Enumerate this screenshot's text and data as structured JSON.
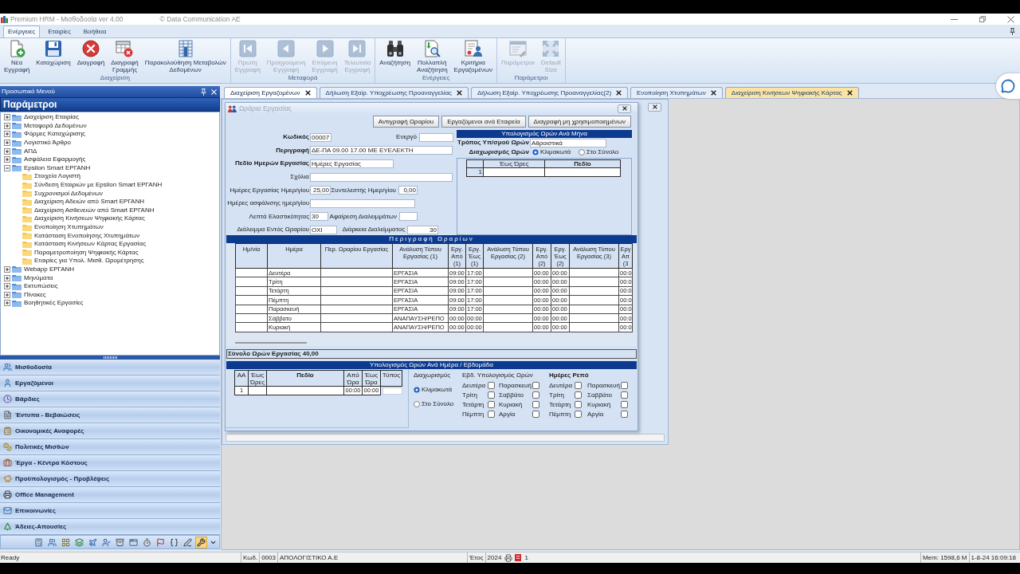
{
  "window": {
    "title": "Premium HRM - Μισθοδοσία ver 4.00",
    "copyright": "© Data Communication AE"
  },
  "ribbon": {
    "tabs": [
      {
        "label": "Ενέργειες",
        "selected": true
      },
      {
        "label": "Εταιρίες",
        "selected": false
      },
      {
        "label": "Βοήθεια",
        "selected": false
      }
    ],
    "groups": [
      {
        "label": "Διαχείριση",
        "buttons": [
          {
            "kind": "new",
            "lines": [
              "Νέα",
              "Εγγραφή"
            ],
            "disabled": false
          },
          {
            "kind": "save",
            "lines": [
              "Καταχώριση"
            ],
            "disabled": false
          },
          {
            "kind": "delete",
            "lines": [
              "Διαγραφή"
            ],
            "disabled": false
          },
          {
            "kind": "delete_row",
            "lines": [
              "Διαγραφή",
              "Γραμμής"
            ],
            "disabled": false
          },
          {
            "kind": "track",
            "lines": [
              "Παρακολούθηση Μεταβολών",
              "Δεδομένων"
            ],
            "disabled": false
          }
        ]
      },
      {
        "label": "Μεταφορά",
        "buttons": [
          {
            "kind": "first",
            "lines": [
              "Πρώτη",
              "Εγγραφή"
            ],
            "disabled": true
          },
          {
            "kind": "prev",
            "lines": [
              "Προηγούμενη",
              "Εγγραφή"
            ],
            "disabled": true
          },
          {
            "kind": "next",
            "lines": [
              "Επόμενη",
              "Εγγραφή"
            ],
            "disabled": true
          },
          {
            "kind": "last",
            "lines": [
              "Τελευταία",
              "Εγγραφή"
            ],
            "disabled": true
          }
        ]
      },
      {
        "label": "Ενέργειες",
        "buttons": [
          {
            "kind": "search",
            "lines": [
              "Αναζήτηση"
            ],
            "disabled": false
          },
          {
            "kind": "multi_search",
            "lines": [
              "Πολλαπλή",
              "Αναζήτηση"
            ],
            "disabled": false
          },
          {
            "kind": "criteria",
            "lines": [
              "Κριτήρια",
              "Εργαζομένων"
            ],
            "disabled": false
          }
        ]
      },
      {
        "label": "Παράμετροι",
        "buttons": [
          {
            "kind": "params",
            "lines": [
              "Παράμετροι"
            ],
            "disabled": true
          },
          {
            "kind": "default_size",
            "lines": [
              "Default",
              "Size"
            ],
            "disabled": true
          }
        ]
      }
    ]
  },
  "personal_menu": {
    "title": "Προσωπικό Μενού",
    "section": "Παράμετροι",
    "tree": [
      {
        "label": "Διαχείριση Εταιρίας",
        "expanded": false
      },
      {
        "label": "Μεταφορά Δεδομένων",
        "expanded": false
      },
      {
        "label": "Φόρμες Καταχώρισης",
        "expanded": false
      },
      {
        "label": "Λογιστικό Άρθρο",
        "expanded": false
      },
      {
        "label": "ΑΠΔ",
        "expanded": false
      },
      {
        "label": "Ασφάλεια Εφαρμογής",
        "expanded": false
      },
      {
        "label": "Epsilon Smart ΕΡΓΑΝΗ",
        "expanded": true,
        "children": [
          {
            "label": "Στοιχεία Λογιστή"
          },
          {
            "label": "Σύνδεση Εταιριών με Epsilon Smart ΕΡΓΑΝΗ"
          },
          {
            "label": "Συχρονισμοί Δεδομένων"
          },
          {
            "label": "Διαχείριση Αδειών από Smart ΕΡΓΑΝΗ"
          },
          {
            "label": "Διαχείριση Ασθενειών από Smart ΕΡΓΑΝΗ"
          },
          {
            "label": "Διαχείριση Κινήσεων Ψηφιακής Κάρτας"
          },
          {
            "label": "Ενοποίηση Χτυπημάτων"
          },
          {
            "label": "Κατάσταση Ενοποίησης Χτυπημάτων"
          },
          {
            "label": "Κατάσταση Κινήσεων Κάρτας Εργασίας"
          },
          {
            "label": "Παραμετροποίηση Ψηφιακής Κάρτας"
          },
          {
            "label": "Εταιρίες για Υπολ. Μισθ. Ωρομέτρησης"
          }
        ]
      },
      {
        "label": "Webapp ΕΡΓΑΝΗ",
        "expanded": false
      },
      {
        "label": "Μηνύματα",
        "expanded": false
      },
      {
        "label": "Εκτυπώσεις",
        "expanded": false
      },
      {
        "label": "Πίνακες",
        "expanded": false
      },
      {
        "label": "Βοηθητικές Εργασίες",
        "expanded": false
      }
    ],
    "nav_items": [
      {
        "label": "Μισθοδοσία",
        "kind": "payroll"
      },
      {
        "label": "Εργαζόμενοι",
        "kind": "employees"
      },
      {
        "label": "Βάρδιες",
        "kind": "shifts"
      },
      {
        "label": "Έντυπα - Βεβαιώσεις",
        "kind": "forms"
      },
      {
        "label": "Οικονομικές Αναφορές",
        "kind": "reports"
      },
      {
        "label": "Πολιτικές Μισθών",
        "kind": "policies"
      },
      {
        "label": "Έργα - Κέντρα Κόστους",
        "kind": "projects"
      },
      {
        "label": "Προϋπολογισμός - Προβλέψεις",
        "kind": "budget"
      },
      {
        "label": "Office Management",
        "kind": "office"
      },
      {
        "label": "Επικοινωνίες",
        "kind": "communication"
      },
      {
        "label": "Άδειες-Απουσίες",
        "kind": "leave"
      }
    ],
    "shortcuts": [
      {
        "kind": "calculator",
        "selected": false
      },
      {
        "kind": "users",
        "selected": false
      },
      {
        "kind": "grid",
        "selected": false
      },
      {
        "kind": "layers",
        "selected": false
      },
      {
        "kind": "plane",
        "selected": false
      },
      {
        "kind": "user_check",
        "selected": false
      },
      {
        "kind": "archive",
        "selected": false
      },
      {
        "kind": "window",
        "selected": false
      },
      {
        "kind": "timer",
        "selected": false
      },
      {
        "kind": "flag",
        "selected": false
      },
      {
        "kind": "braces",
        "selected": false
      },
      {
        "kind": "pen",
        "selected": false
      },
      {
        "kind": "wrench",
        "selected": true
      }
    ]
  },
  "doc_tabs": [
    {
      "label": "Διαχείριση Εργαζομένων",
      "selected": true,
      "highlighted": false
    },
    {
      "label": "Δήλωση Εξαίρ. Υποχρέωσης Προαναγγελίας",
      "selected": false,
      "highlighted": false
    },
    {
      "label": "Δήλωση Εξαίρ. Υποχρέωσης Προαναγγελίας(2)",
      "selected": false,
      "highlighted": false
    },
    {
      "label": "Ενοποίηση Χτυπημάτων",
      "selected": false,
      "highlighted": false
    },
    {
      "label": "Διαχείριση Κινήσεων Ψηφιακής Κάρτας",
      "selected": false,
      "highlighted": true
    }
  ],
  "dialog": {
    "title": "Ωράρια Εργασίας",
    "buttons": [
      "Αντιγραφή Ωραρίου",
      "Εργαζόμενοι ανά Εταιρεία",
      "Διαγραφή μη χρησιμοποιημένων"
    ],
    "form": [
      [
        {
          "label": "Κωδικός",
          "value": "00007",
          "bold": true
        },
        {
          "label": "Ενεργό",
          "bold": false
        }
      ],
      [
        {
          "label": "Περιγραφή",
          "value": "ΔΕ-ΠΑ 09.00 17.00 ΜΕ ΕΥΕΛΕΚΤΗ",
          "bold": true
        }
      ],
      [
        {
          "label": "Πεδίο Ημερών Εργασίας",
          "value": "Ημέρες Εργασίας",
          "bold": true
        }
      ],
      [
        {
          "label": "Σχόλια",
          "bold": false
        }
      ],
      [
        {
          "label": "Ημέρες Εργασίας Ημερ/γίου",
          "value": "25,00",
          "bold": false
        },
        {
          "label": "Συντελεστής Ημερ/γίου",
          "value": "0,00",
          "bold": false
        }
      ],
      [
        {
          "label": "Ημέρες ασφάλισης ημερ/γίου",
          "bold": false
        }
      ],
      [
        {
          "label": "Λεπτά Ελαστικότητας",
          "value": "30",
          "bold": false
        },
        {
          "label": "Αφαίρεση Διαλειμμάτων",
          "bold": false
        }
      ],
      [
        {
          "label": "Διάλειμμα Εντός Ωραρίου",
          "value": "ΟΧΙ",
          "bold": false
        },
        {
          "label": "Διάρκεια Διαλείμματος",
          "value": "30",
          "bold": false
        }
      ]
    ],
    "monthly": {
      "title": "Υπολογισμός Ωρών Ανά Μήνα",
      "method_label": "Τρόπος Υπ/σμού Ωρών",
      "method_value": "Αθροιστικά",
      "split_label": "Διαχωρισμός Ωρών",
      "split_options": [
        {
          "label": "Κλιμακωτά",
          "selected": true
        },
        {
          "label": "Στο Σύνολο",
          "selected": false
        }
      ],
      "columns": [
        "Έως Ώρες",
        "Πεδίο"
      ],
      "rows": [
        {
          "number": "1"
        }
      ]
    },
    "schedule": {
      "title": "Περιγραφή Ωραρίων",
      "columns": [
        "Ημ/νία",
        "Ημέρα",
        "Περ. Ωραρίου Εργασίας",
        "Ανάλυση Τύπου Εργασίας (1)",
        "Εργ. Από (1)",
        "Εργ. Έως (1)",
        "Ανάλυση Τύπου Εργασίας (2)",
        "Εργ. Από (2)",
        "Εργ. Έως (2)",
        "Ανάλυση Τύπου Εργασίας (3)",
        "Εργ Απ (3"
      ],
      "rows": [
        {
          "day": "Δευτέρα",
          "type_1": "ΕΡΓΑΣΙΑ",
          "from_1": "09:00",
          "to_1": "17:00",
          "from_2": "00:00",
          "to_2": "00:00",
          "from_3": "00:0"
        },
        {
          "day": "Τρίτη",
          "type_1": "ΕΡΓΑΣΙΑ",
          "from_1": "09:00",
          "to_1": "17:00",
          "from_2": "00:00",
          "to_2": "00:00",
          "from_3": "00:0"
        },
        {
          "day": "Τετάρτη",
          "type_1": "ΕΡΓΑΣΙΑ",
          "from_1": "09:00",
          "to_1": "17:00",
          "from_2": "00:00",
          "to_2": "00:00",
          "from_3": "00:0"
        },
        {
          "day": "Πέμπτη",
          "type_1": "ΕΡΓΑΣΙΑ",
          "from_1": "09:00",
          "to_1": "17:00",
          "from_2": "00:00",
          "to_2": "00:00",
          "from_3": "00:0"
        },
        {
          "day": "Παρασκευή",
          "type_1": "ΕΡΓΑΣΙΑ",
          "from_1": "09:00",
          "to_1": "17:00",
          "from_2": "00:00",
          "to_2": "00:00",
          "from_3": "00:0"
        },
        {
          "day": "Σάββατο",
          "type_1": "ΑΝΑΠΑΥΣΗ/ΡΕΠΟ",
          "from_1": "00:00",
          "to_1": "00:00",
          "from_2": "00:00",
          "to_2": "00:00",
          "from_3": "00:0"
        },
        {
          "day": "Κυριακή",
          "type_1": "ΑΝΑΠΑΥΣΗ/ΡΕΠΟ",
          "from_1": "00:00",
          "to_1": "00:00",
          "from_2": "00:00",
          "to_2": "00:00",
          "from_3": "00:0"
        }
      ]
    },
    "total": "Σύνολο Ωρών Εργασίας 40,00",
    "daily": {
      "title": "Υπολογισμός Ωρών Ανά Ημέρα / Εβδομάδα",
      "columns": [
        "ΑΑ",
        "Έως Ώρες",
        "Πεδίο",
        "Από Ώρα",
        "Έως Ώρα",
        "Τύπος"
      ],
      "rows": [
        {
          "aa": "1",
          "from": "00:00",
          "to": "00:00"
        }
      ],
      "split_label": "Διαχωρισμός",
      "split_options": [
        {
          "label": "Κλιμακωτά",
          "selected": true
        },
        {
          "label": "Στο Σύνολο",
          "selected": false
        }
      ],
      "weekly": {
        "title": "Εβδ. Υπολογισμός Ωρών",
        "days": [
          {
            "label": "Δευτέρα",
            "checked": false
          },
          {
            "label": "Παρασκευή",
            "checked": false
          },
          {
            "label": "Τρίτη",
            "checked": false
          },
          {
            "label": "Σαββάτο",
            "checked": false
          },
          {
            "label": "Τετάρτη",
            "checked": false
          },
          {
            "label": "Κυριακή",
            "checked": false
          },
          {
            "label": "Πέμπτη",
            "checked": false
          },
          {
            "label": "Αργία",
            "checked": false
          }
        ]
      },
      "rest_days": {
        "title": "Ημέρες Ρεπό",
        "days": [
          {
            "label": "Δευτέρα",
            "checked": false
          },
          {
            "label": "Παρασκευή",
            "checked": false
          },
          {
            "label": "Τρίτη",
            "checked": false
          },
          {
            "label": "Σαββάτο",
            "checked": false
          },
          {
            "label": "Τετάρτη",
            "checked": false
          },
          {
            "label": "Κυριακή",
            "checked": false
          },
          {
            "label": "Πέμπτη",
            "checked": false
          },
          {
            "label": "Αργία",
            "checked": false
          }
        ]
      }
    }
  },
  "status_bar": {
    "state": "Ready",
    "company_label": "Κωδ.",
    "company_code": "0003",
    "company_name": "ΑΠΟΛΟΓΙΣΤΙΚΟ Α.Ε",
    "year_label": "Έτος",
    "year": "2024",
    "count": "1",
    "memory": "Mem: 1598,6 M",
    "datetime": "1-8-24 16:09:18"
  }
}
